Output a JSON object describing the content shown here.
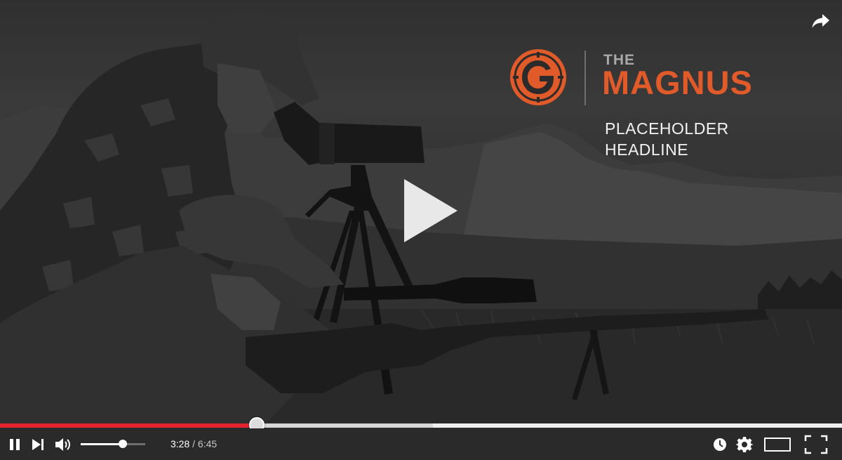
{
  "brand": {
    "the": "THE",
    "name": "MAGNUS",
    "headline_line1": "PLACEHOLDER",
    "headline_line2": "HEADLINE",
    "accent_color": "#e05a2a",
    "logo": "g-logo-icon"
  },
  "player": {
    "current_time": "3:28",
    "separator": "/",
    "duration": "6:45",
    "progress": 0.514,
    "buffered": 0.305,
    "volume": 0.65,
    "state": "paused-overlay",
    "progress_color": "#e6222f"
  },
  "icons": {
    "share": "share-arrow-icon",
    "big_play": "play-icon",
    "pause": "pause-icon",
    "next": "next-track-icon",
    "volume": "volume-icon",
    "watch_later": "clock-icon",
    "settings": "gear-icon",
    "theater": "theater-mode-icon",
    "fullscreen": "fullscreen-icon"
  }
}
